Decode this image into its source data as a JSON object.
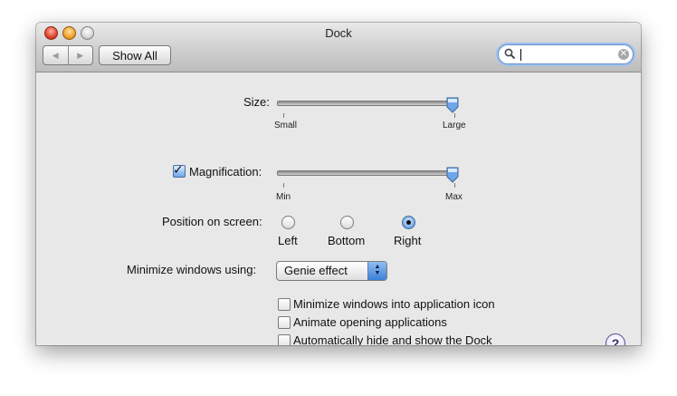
{
  "window": {
    "title": "Dock"
  },
  "toolbar": {
    "back_symbol": "◀",
    "forward_symbol": "▶",
    "show_all_label": "Show All",
    "search_value": "",
    "clear_symbol": "✕"
  },
  "size": {
    "label": "Size:",
    "min_label": "Small",
    "max_label": "Large",
    "value_percent": 100
  },
  "magnification": {
    "label": "Magnification:",
    "checked": true,
    "check_symbol": "✓",
    "min_label": "Min",
    "max_label": "Max",
    "value_percent": 100
  },
  "position": {
    "label": "Position on screen:",
    "options": [
      "Left",
      "Bottom",
      "Right"
    ],
    "selected": "Right"
  },
  "minimize": {
    "label": "Minimize windows using:",
    "selected": "Genie effect",
    "arrow_up": "▲",
    "arrow_down": "▼"
  },
  "options": [
    {
      "label": "Minimize windows into application icon",
      "checked": false
    },
    {
      "label": "Animate opening applications",
      "checked": false
    },
    {
      "label": "Automatically hide and show the Dock",
      "checked": false
    }
  ],
  "help": {
    "symbol": "?"
  },
  "colors": {
    "selection_blue": "#6fa6e8",
    "window_background": "#e8e8e8"
  }
}
